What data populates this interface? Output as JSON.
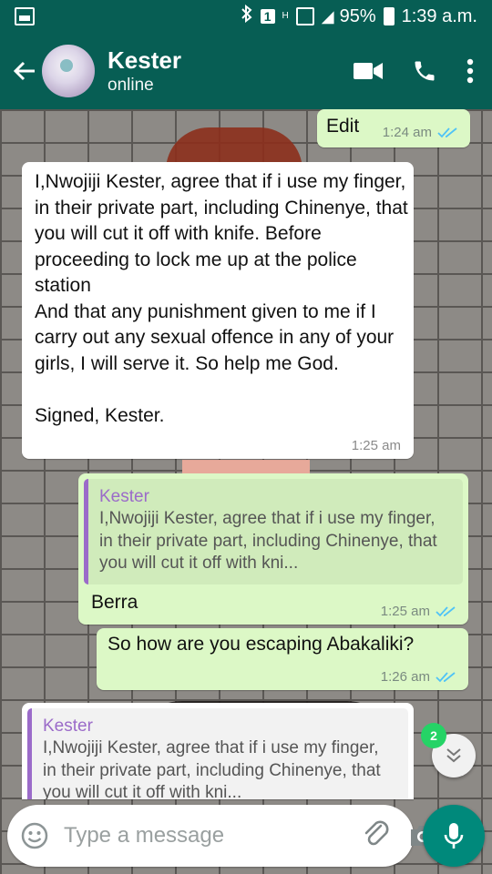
{
  "status_bar": {
    "sim": "1",
    "network": "H",
    "battery": "95%",
    "time": "1:39 a.m."
  },
  "header": {
    "contact_name": "Kester",
    "contact_status": "online"
  },
  "messages": [
    {
      "type": "outgoing",
      "text": "Edit",
      "time": "1:24 am",
      "read": true
    },
    {
      "type": "incoming",
      "text": "I,Nwojiji Kester, agree that if i use my finger, in their private part, including Chinenye, that you will cut it off with knife. Before proceeding to lock me up at the police station\nAnd that any punishment given to me if I carry out any sexual offence in any of your girls, I will serve it. So help me God.\n\nSigned, Kester.",
      "time": "1:25 am"
    },
    {
      "type": "outgoing",
      "quote": {
        "name": "Kester",
        "text": "I,Nwojiji Kester, agree that if i use my finger, in their private part, including Chinenye, that you will cut it off with kni..."
      },
      "text": "Berra",
      "time": "1:25 am",
      "read": true
    },
    {
      "type": "outgoing",
      "text": "So how are you escaping Abakaliki?",
      "time": "1:26 am",
      "read": true
    },
    {
      "type": "incoming",
      "quote": {
        "name": "Kester",
        "text": "I,Nwojiji Kester, agree that if i use my finger, in their private part, including Chinenye, that you will cut it off with kni..."
      }
    }
  ],
  "unread_count": "2",
  "composer": {
    "placeholder": "Type a message"
  },
  "colors": {
    "header": "#075e54",
    "outgoing_bubble": "#dcf8c6",
    "incoming_bubble": "#ffffff",
    "quote_accent": "#9b6bc9",
    "read_ticks": "#4fc3f7",
    "mic_button": "#00897b",
    "unread_badge": "#25d366"
  },
  "icons": {
    "status_left": "gallery-icon",
    "back": "arrow-left-icon",
    "video": "video-camera-icon",
    "call": "phone-icon",
    "menu": "more-vert-icon",
    "read": "double-check-icon",
    "scroll": "chevron-double-down-icon",
    "emoji": "emoji-icon",
    "attach": "paperclip-icon",
    "camera": "camera-icon",
    "mic": "mic-icon"
  }
}
